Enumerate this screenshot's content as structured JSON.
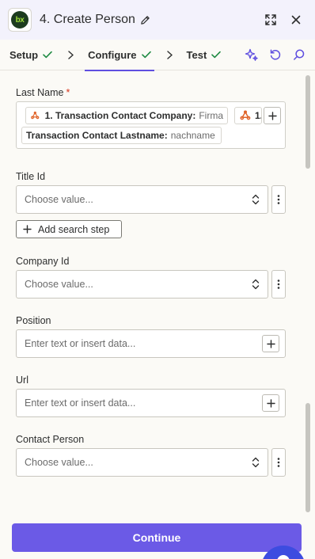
{
  "header": {
    "app_logo_text": "bx",
    "title": "4. Create Person"
  },
  "tabs": [
    {
      "label": "Setup"
    },
    {
      "label": "Configure"
    },
    {
      "label": "Test"
    }
  ],
  "fields": {
    "last_name": {
      "label": "Last Name",
      "required_mark": "*",
      "tokens": [
        {
          "step": "1. Transaction Contact Company:",
          "value": "Firma"
        },
        {
          "step": "1.",
          "value": ""
        },
        {
          "step": "Transaction Contact Lastname:",
          "value": "nachname"
        }
      ]
    },
    "title_id": {
      "label": "Title Id",
      "placeholder": "Choose value..."
    },
    "add_search_step": {
      "label": "Add search step"
    },
    "company_id": {
      "label": "Company Id",
      "placeholder": "Choose value..."
    },
    "position": {
      "label": "Position",
      "placeholder": "Enter text or insert data..."
    },
    "url": {
      "label": "Url",
      "placeholder": "Enter text or insert data..."
    },
    "contact_person": {
      "label": "Contact Person",
      "placeholder": "Choose value..."
    }
  },
  "footer": {
    "continue_label": "Continue"
  },
  "colors": {
    "accent": "#6b5ae6",
    "tab_underline": "#5f4fe0",
    "check_green": "#1e8a42",
    "required_red": "#d6331a",
    "token_icon": "#e0642a"
  },
  "icons": [
    "app-logo",
    "pencil-icon",
    "expand-icon",
    "close-icon",
    "check-icon",
    "chevron-right-icon",
    "sparkle-icon",
    "refresh-icon",
    "search-icon",
    "webhook-icon",
    "plus-icon",
    "updown-icon",
    "kebab-icon",
    "chat-icon"
  ]
}
